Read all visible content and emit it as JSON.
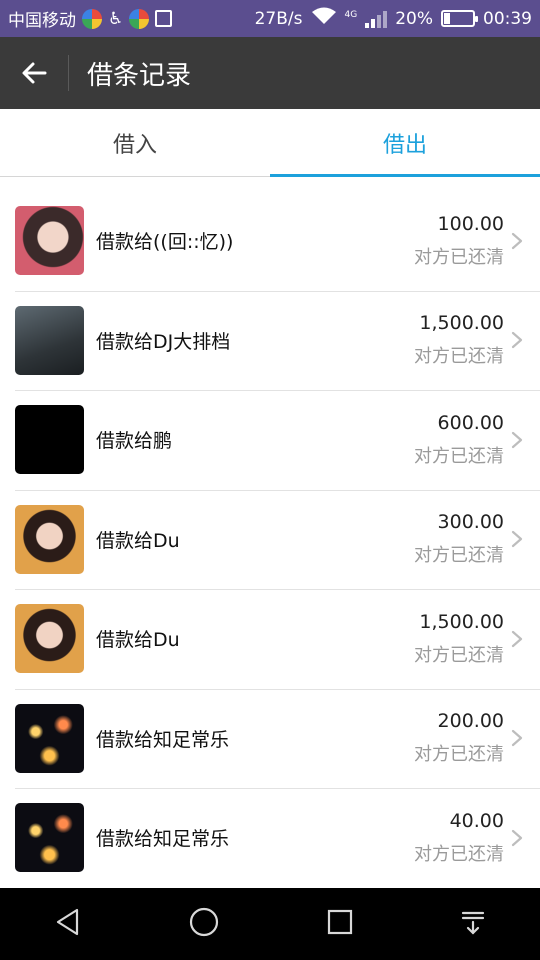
{
  "status_bar": {
    "carrier": "中国移动",
    "net_speed": "27B/s",
    "network_type": "4G",
    "battery": "20%",
    "battery_level": 0.2,
    "time": "00:39"
  },
  "header": {
    "title": "借条记录"
  },
  "tabs": [
    {
      "label": "借入",
      "active": false
    },
    {
      "label": "借出",
      "active": true
    }
  ],
  "records": [
    {
      "name": "借款给((回::忆))",
      "amount": "100.00",
      "status": "对方已还清"
    },
    {
      "name": "借款给DJ大排档",
      "amount": "1,500.00",
      "status": "对方已还清"
    },
    {
      "name": "借款给鹏",
      "amount": "600.00",
      "status": "对方已还清"
    },
    {
      "name": "借款给Du",
      "amount": "300.00",
      "status": "对方已还清"
    },
    {
      "name": "借款给Du",
      "amount": "1,500.00",
      "status": "对方已还清"
    },
    {
      "name": "借款给知足常乐",
      "amount": "200.00",
      "status": "对方已还清"
    },
    {
      "name": "借款给知足常乐",
      "amount": "40.00",
      "status": "对方已还清"
    }
  ],
  "colors": {
    "accent": "#1da1dc",
    "app_bar": "#3a3a3a",
    "status_bar": "#5b4e8f"
  }
}
